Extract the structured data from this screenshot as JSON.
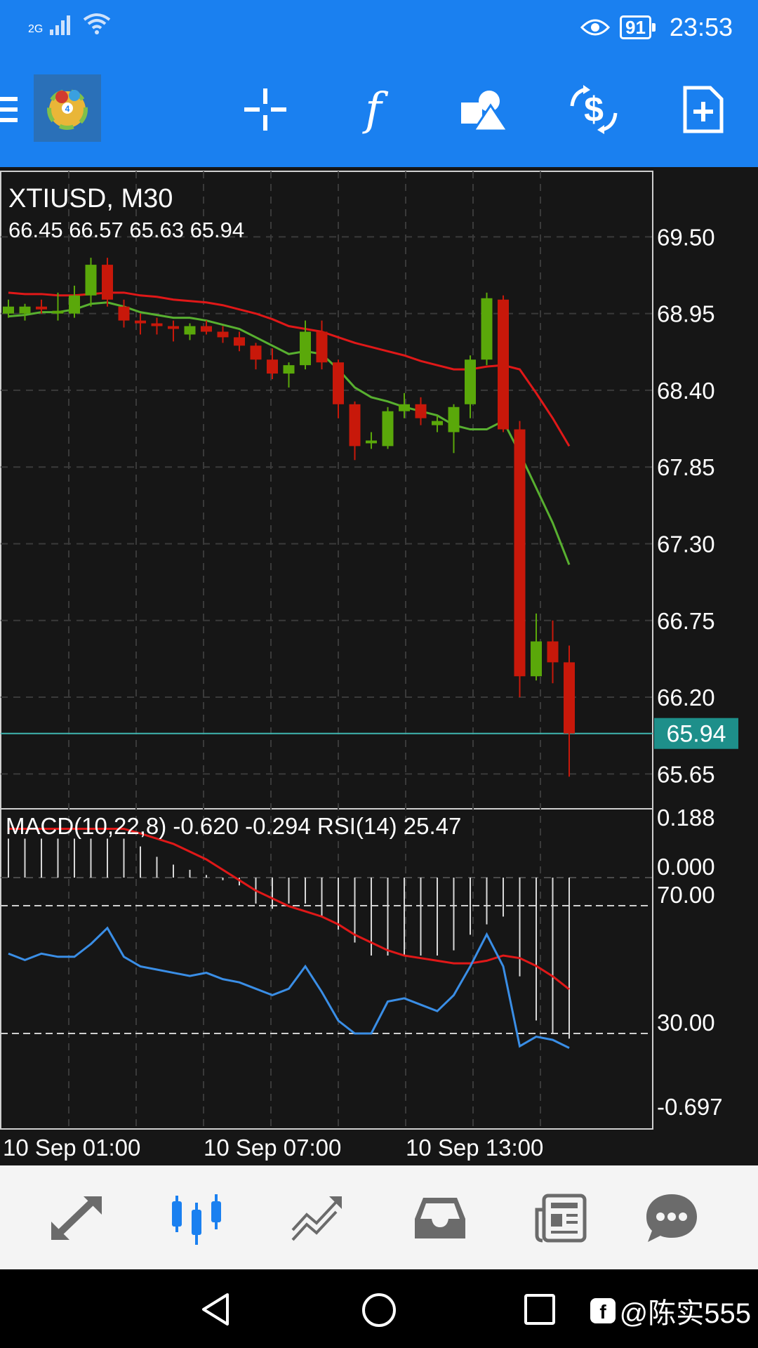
{
  "status_bar": {
    "network": "2G",
    "battery": "91",
    "time": "23:53"
  },
  "toolbar": {
    "buttons": [
      "menu-icon",
      "mt4-logo",
      "crosshair-icon",
      "indicators-icon",
      "objects-icon",
      "symbol-icon",
      "new-order-icon"
    ]
  },
  "chart": {
    "symbol_timeframe": "XTIUSD, M30",
    "ohlc": "66.45 66.57 65.63 65.94",
    "current_price": "65.94",
    "indicator_label": "MACD(10,22,8) -0.620 -0.294 RSI(14) 25.47"
  },
  "chart_data": {
    "type": "candlestick",
    "title": "XTIUSD, M30",
    "price_ticks": [
      "69.50",
      "68.95",
      "68.40",
      "67.85",
      "67.30",
      "66.75",
      "66.20",
      "65.65"
    ],
    "indicator_ticks": [
      "0.188",
      "0.000",
      "70.00",
      "30.00",
      "-0.697"
    ],
    "time_labels": [
      "10 Sep 01:00",
      "10 Sep 07:00",
      "10 Sep 13:00"
    ],
    "ylim": [
      65.4,
      70.0
    ],
    "current_price": 65.94,
    "candles": [
      {
        "o": 68.95,
        "h": 69.05,
        "l": 68.92,
        "c": 69.0
      },
      {
        "o": 68.95,
        "h": 69.02,
        "l": 68.9,
        "c": 69.0
      },
      {
        "o": 69.0,
        "h": 69.05,
        "l": 68.95,
        "c": 68.98
      },
      {
        "o": 68.95,
        "h": 69.1,
        "l": 68.9,
        "c": 68.97
      },
      {
        "o": 68.95,
        "h": 69.15,
        "l": 68.92,
        "c": 69.08
      },
      {
        "o": 69.08,
        "h": 69.35,
        "l": 69.0,
        "c": 69.3
      },
      {
        "o": 69.3,
        "h": 69.35,
        "l": 69.0,
        "c": 69.05
      },
      {
        "o": 69.0,
        "h": 69.05,
        "l": 68.85,
        "c": 68.9
      },
      {
        "o": 68.9,
        "h": 68.95,
        "l": 68.8,
        "c": 68.88
      },
      {
        "o": 68.88,
        "h": 68.92,
        "l": 68.8,
        "c": 68.86
      },
      {
        "o": 68.86,
        "h": 68.9,
        "l": 68.75,
        "c": 68.84
      },
      {
        "o": 68.8,
        "h": 68.88,
        "l": 68.76,
        "c": 68.86
      },
      {
        "o": 68.86,
        "h": 68.9,
        "l": 68.8,
        "c": 68.82
      },
      {
        "o": 68.82,
        "h": 68.86,
        "l": 68.74,
        "c": 68.78
      },
      {
        "o": 68.78,
        "h": 68.82,
        "l": 68.68,
        "c": 68.72
      },
      {
        "o": 68.72,
        "h": 68.74,
        "l": 68.55,
        "c": 68.62
      },
      {
        "o": 68.62,
        "h": 68.7,
        "l": 68.48,
        "c": 68.52
      },
      {
        "o": 68.52,
        "h": 68.6,
        "l": 68.42,
        "c": 68.58
      },
      {
        "o": 68.58,
        "h": 68.9,
        "l": 68.55,
        "c": 68.82
      },
      {
        "o": 68.82,
        "h": 68.9,
        "l": 68.55,
        "c": 68.6
      },
      {
        "o": 68.6,
        "h": 68.62,
        "l": 68.2,
        "c": 68.3
      },
      {
        "o": 68.3,
        "h": 68.32,
        "l": 67.9,
        "c": 68.0
      },
      {
        "o": 68.02,
        "h": 68.1,
        "l": 67.98,
        "c": 68.04
      },
      {
        "o": 68.0,
        "h": 68.28,
        "l": 67.98,
        "c": 68.25
      },
      {
        "o": 68.25,
        "h": 68.38,
        "l": 68.2,
        "c": 68.3
      },
      {
        "o": 68.3,
        "h": 68.35,
        "l": 68.15,
        "c": 68.2
      },
      {
        "o": 68.15,
        "h": 68.22,
        "l": 68.1,
        "c": 68.18
      },
      {
        "o": 68.1,
        "h": 68.3,
        "l": 67.95,
        "c": 68.28
      },
      {
        "o": 68.3,
        "h": 68.65,
        "l": 68.2,
        "c": 68.62
      },
      {
        "o": 68.62,
        "h": 69.1,
        "l": 68.58,
        "c": 69.06
      },
      {
        "o": 69.05,
        "h": 69.08,
        "l": 68.1,
        "c": 68.12
      },
      {
        "o": 68.12,
        "h": 68.18,
        "l": 66.2,
        "c": 66.35
      },
      {
        "o": 66.35,
        "h": 66.8,
        "l": 66.32,
        "c": 66.6
      },
      {
        "o": 66.6,
        "h": 66.75,
        "l": 66.3,
        "c": 66.45
      },
      {
        "o": 66.45,
        "h": 66.57,
        "l": 65.63,
        "c": 65.94
      }
    ],
    "ma_fast": [
      68.93,
      68.94,
      68.96,
      68.96,
      68.98,
      69.02,
      69.03,
      69.0,
      68.96,
      68.94,
      68.92,
      68.92,
      68.9,
      68.87,
      68.84,
      68.78,
      68.72,
      68.66,
      68.68,
      68.66,
      68.55,
      68.42,
      68.35,
      68.32,
      68.28,
      68.25,
      68.22,
      68.15,
      68.12,
      68.12,
      68.18,
      67.95,
      67.7,
      67.45,
      67.15
    ],
    "ma_slow": [
      69.1,
      69.09,
      69.09,
      69.08,
      69.08,
      69.09,
      69.1,
      69.1,
      69.08,
      69.07,
      69.05,
      69.04,
      69.03,
      69.01,
      68.98,
      68.95,
      68.91,
      68.86,
      68.84,
      68.82,
      68.78,
      68.74,
      68.71,
      68.68,
      68.65,
      68.61,
      68.58,
      68.55,
      68.55,
      68.57,
      68.58,
      68.55,
      68.38,
      68.2,
      68.0
    ],
    "macd_hist": [
      0.15,
      0.15,
      0.15,
      0.15,
      0.15,
      0.15,
      0.15,
      0.15,
      0.12,
      0.08,
      0.05,
      0.03,
      0.01,
      -0.01,
      -0.03,
      -0.1,
      -0.12,
      -0.1,
      -0.1,
      -0.15,
      -0.2,
      -0.25,
      -0.3,
      -0.3,
      -0.3,
      -0.3,
      -0.3,
      -0.28,
      -0.22,
      -0.18,
      -0.15,
      -0.38,
      -0.55,
      -0.6,
      -0.62
    ],
    "macd_signal": [
      0.188,
      0.188,
      0.188,
      0.188,
      0.188,
      0.188,
      0.188,
      0.188,
      0.17,
      0.15,
      0.13,
      0.1,
      0.07,
      0.03,
      -0.01,
      -0.05,
      -0.08,
      -0.11,
      -0.13,
      -0.15,
      -0.18,
      -0.22,
      -0.25,
      -0.28,
      -0.3,
      -0.31,
      -0.32,
      -0.33,
      -0.33,
      -0.32,
      -0.3,
      -0.31,
      -0.34,
      -0.38,
      -0.43
    ],
    "rsi": [
      55,
      53,
      55,
      54,
      54,
      58,
      63,
      54,
      51,
      50,
      49,
      48,
      49,
      47,
      46,
      44,
      42,
      44,
      51,
      43,
      34,
      30,
      30,
      40,
      41,
      39,
      37,
      42,
      51,
      61,
      51,
      26,
      29,
      28,
      25.47
    ]
  },
  "bottom_nav": {
    "items": [
      "quotes-icon",
      "chart-icon",
      "trade-icon",
      "history-icon",
      "news-icon",
      "chat-icon"
    ]
  },
  "system_nav": {
    "watermark": "@陈实555"
  }
}
